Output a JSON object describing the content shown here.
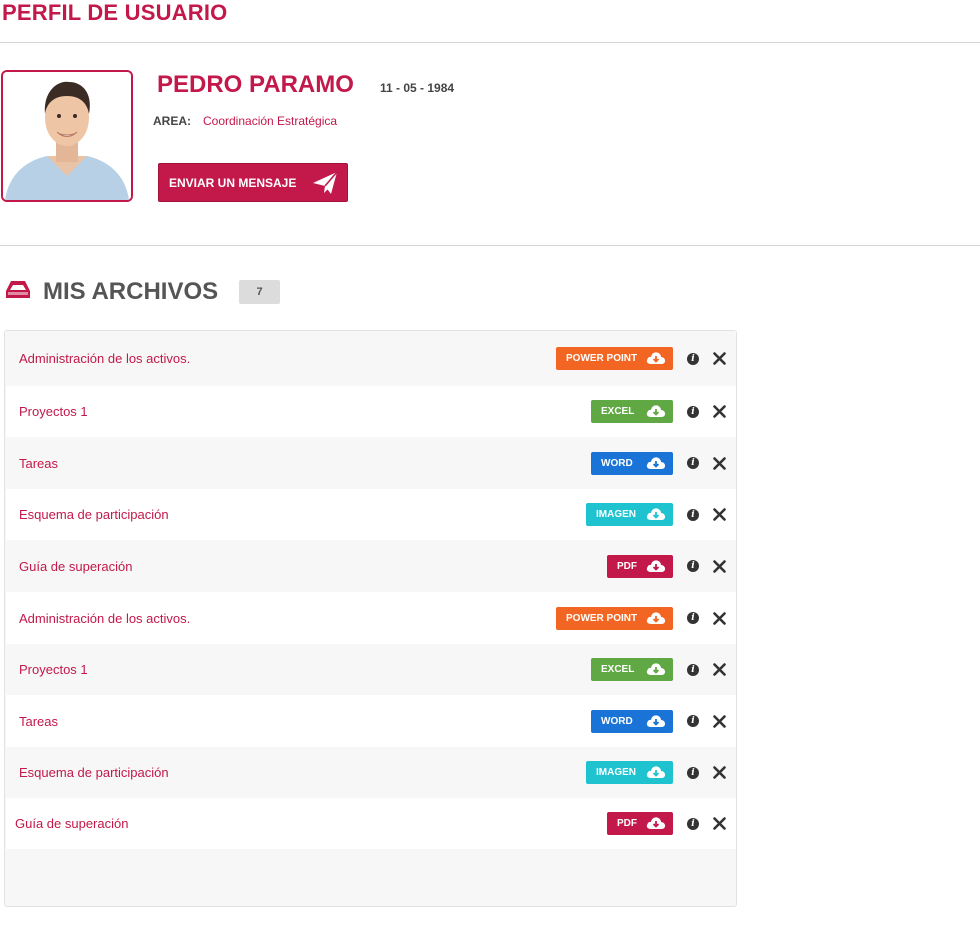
{
  "page": {
    "title": "PERFIL DE USUARIO"
  },
  "profile": {
    "name": "PEDRO PARAMO",
    "dob": "11 - 05 - 1984",
    "area_label": "AREA:",
    "area_value": "Coordinación Estratégica",
    "message_button": "ENVIAR UN MENSAJE"
  },
  "files": {
    "title": "MIS ARCHIVOS",
    "count": "7",
    "items": [
      {
        "name": "Administración de los activos.",
        "type": "POWER POINT",
        "color": "#f26522"
      },
      {
        "name": "Proyectos 1",
        "type": "EXCEL",
        "color": "#5fa843"
      },
      {
        "name": "Tareas",
        "type": "WORD",
        "color": "#1a73d6"
      },
      {
        "name": "Esquema de participación",
        "type": "IMAGEN",
        "color": "#1ec3cf"
      },
      {
        "name": "Guía de superación",
        "type": "PDF",
        "color": "#c2184a"
      },
      {
        "name": "Administración de los activos.",
        "type": "POWER POINT",
        "color": "#f26522"
      },
      {
        "name": "Proyectos 1",
        "type": "EXCEL",
        "color": "#5fa843"
      },
      {
        "name": "Tareas",
        "type": "WORD",
        "color": "#1a73d6"
      },
      {
        "name": "Esquema de participación",
        "type": "IMAGEN",
        "color": "#1ec3cf"
      },
      {
        "name": "Guía de superación",
        "type": "PDF",
        "color": "#c2184a"
      }
    ]
  },
  "icons": {
    "header": "inbox-tray-icon",
    "send": "paper-plane-icon",
    "download": "cloud-download-icon",
    "info": "info-icon",
    "delete": "close-icon"
  },
  "colors": {
    "brand": "#c2184a"
  }
}
